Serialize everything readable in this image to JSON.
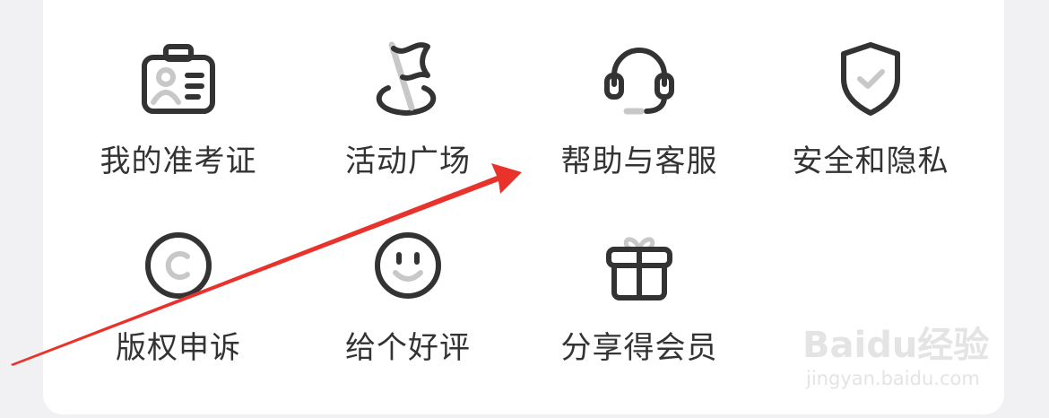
{
  "grid": {
    "items": [
      {
        "label": "我的准考证",
        "icon": "id-badge-icon"
      },
      {
        "label": "活动广场",
        "icon": "flag-icon"
      },
      {
        "label": "帮助与客服",
        "icon": "headset-icon"
      },
      {
        "label": "安全和隐私",
        "icon": "shield-check-icon"
      },
      {
        "label": "版权申诉",
        "icon": "copyright-icon"
      },
      {
        "label": "给个好评",
        "icon": "smiley-icon"
      },
      {
        "label": "分享得会员",
        "icon": "gift-icon"
      }
    ]
  },
  "colors": {
    "icon_stroke": "#333333",
    "icon_accent": "#c8c8c8",
    "arrow": "#e8322c",
    "card": "#ffffff",
    "background": "#f1f1f3"
  },
  "watermark": {
    "logo": "Baidu经验",
    "url": "jingyan.baidu.com"
  }
}
